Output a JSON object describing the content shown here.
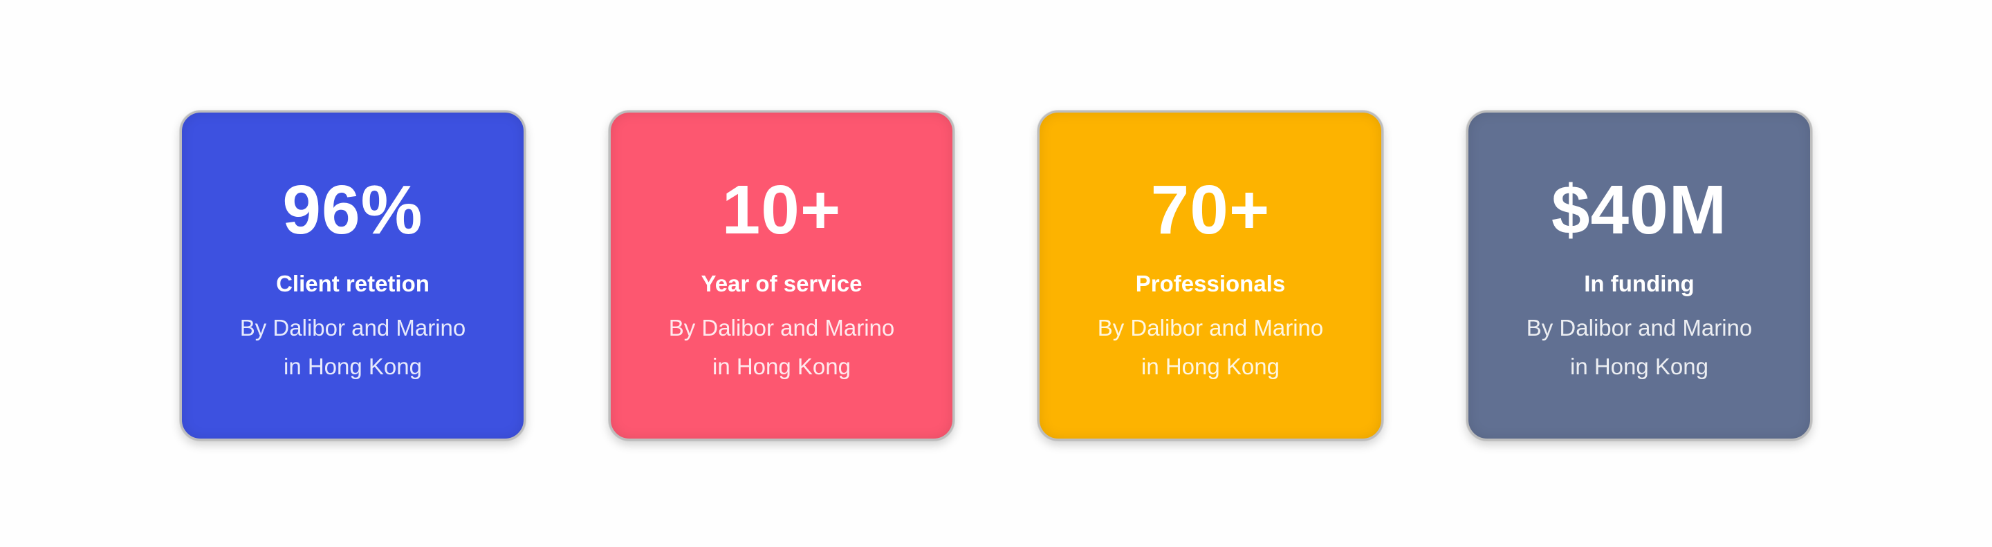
{
  "stats": [
    {
      "value": "96%",
      "label": "Client retetion",
      "desc_line1": "By Dalibor and Marino",
      "desc_line2": "in Hong Kong",
      "color": "#3d51e0"
    },
    {
      "value": "10+",
      "label": "Year of service",
      "desc_line1": "By Dalibor and Marino",
      "desc_line2": "in Hong Kong",
      "color": "#fd5770"
    },
    {
      "value": "70+",
      "label": "Professionals",
      "desc_line1": "By Dalibor and Marino",
      "desc_line2": "in Hong Kong",
      "color": "#fdb300"
    },
    {
      "value": "$40M",
      "label": "In funding",
      "desc_line1": "By Dalibor and Marino",
      "desc_line2": "in Hong Kong",
      "color": "#617092"
    }
  ]
}
